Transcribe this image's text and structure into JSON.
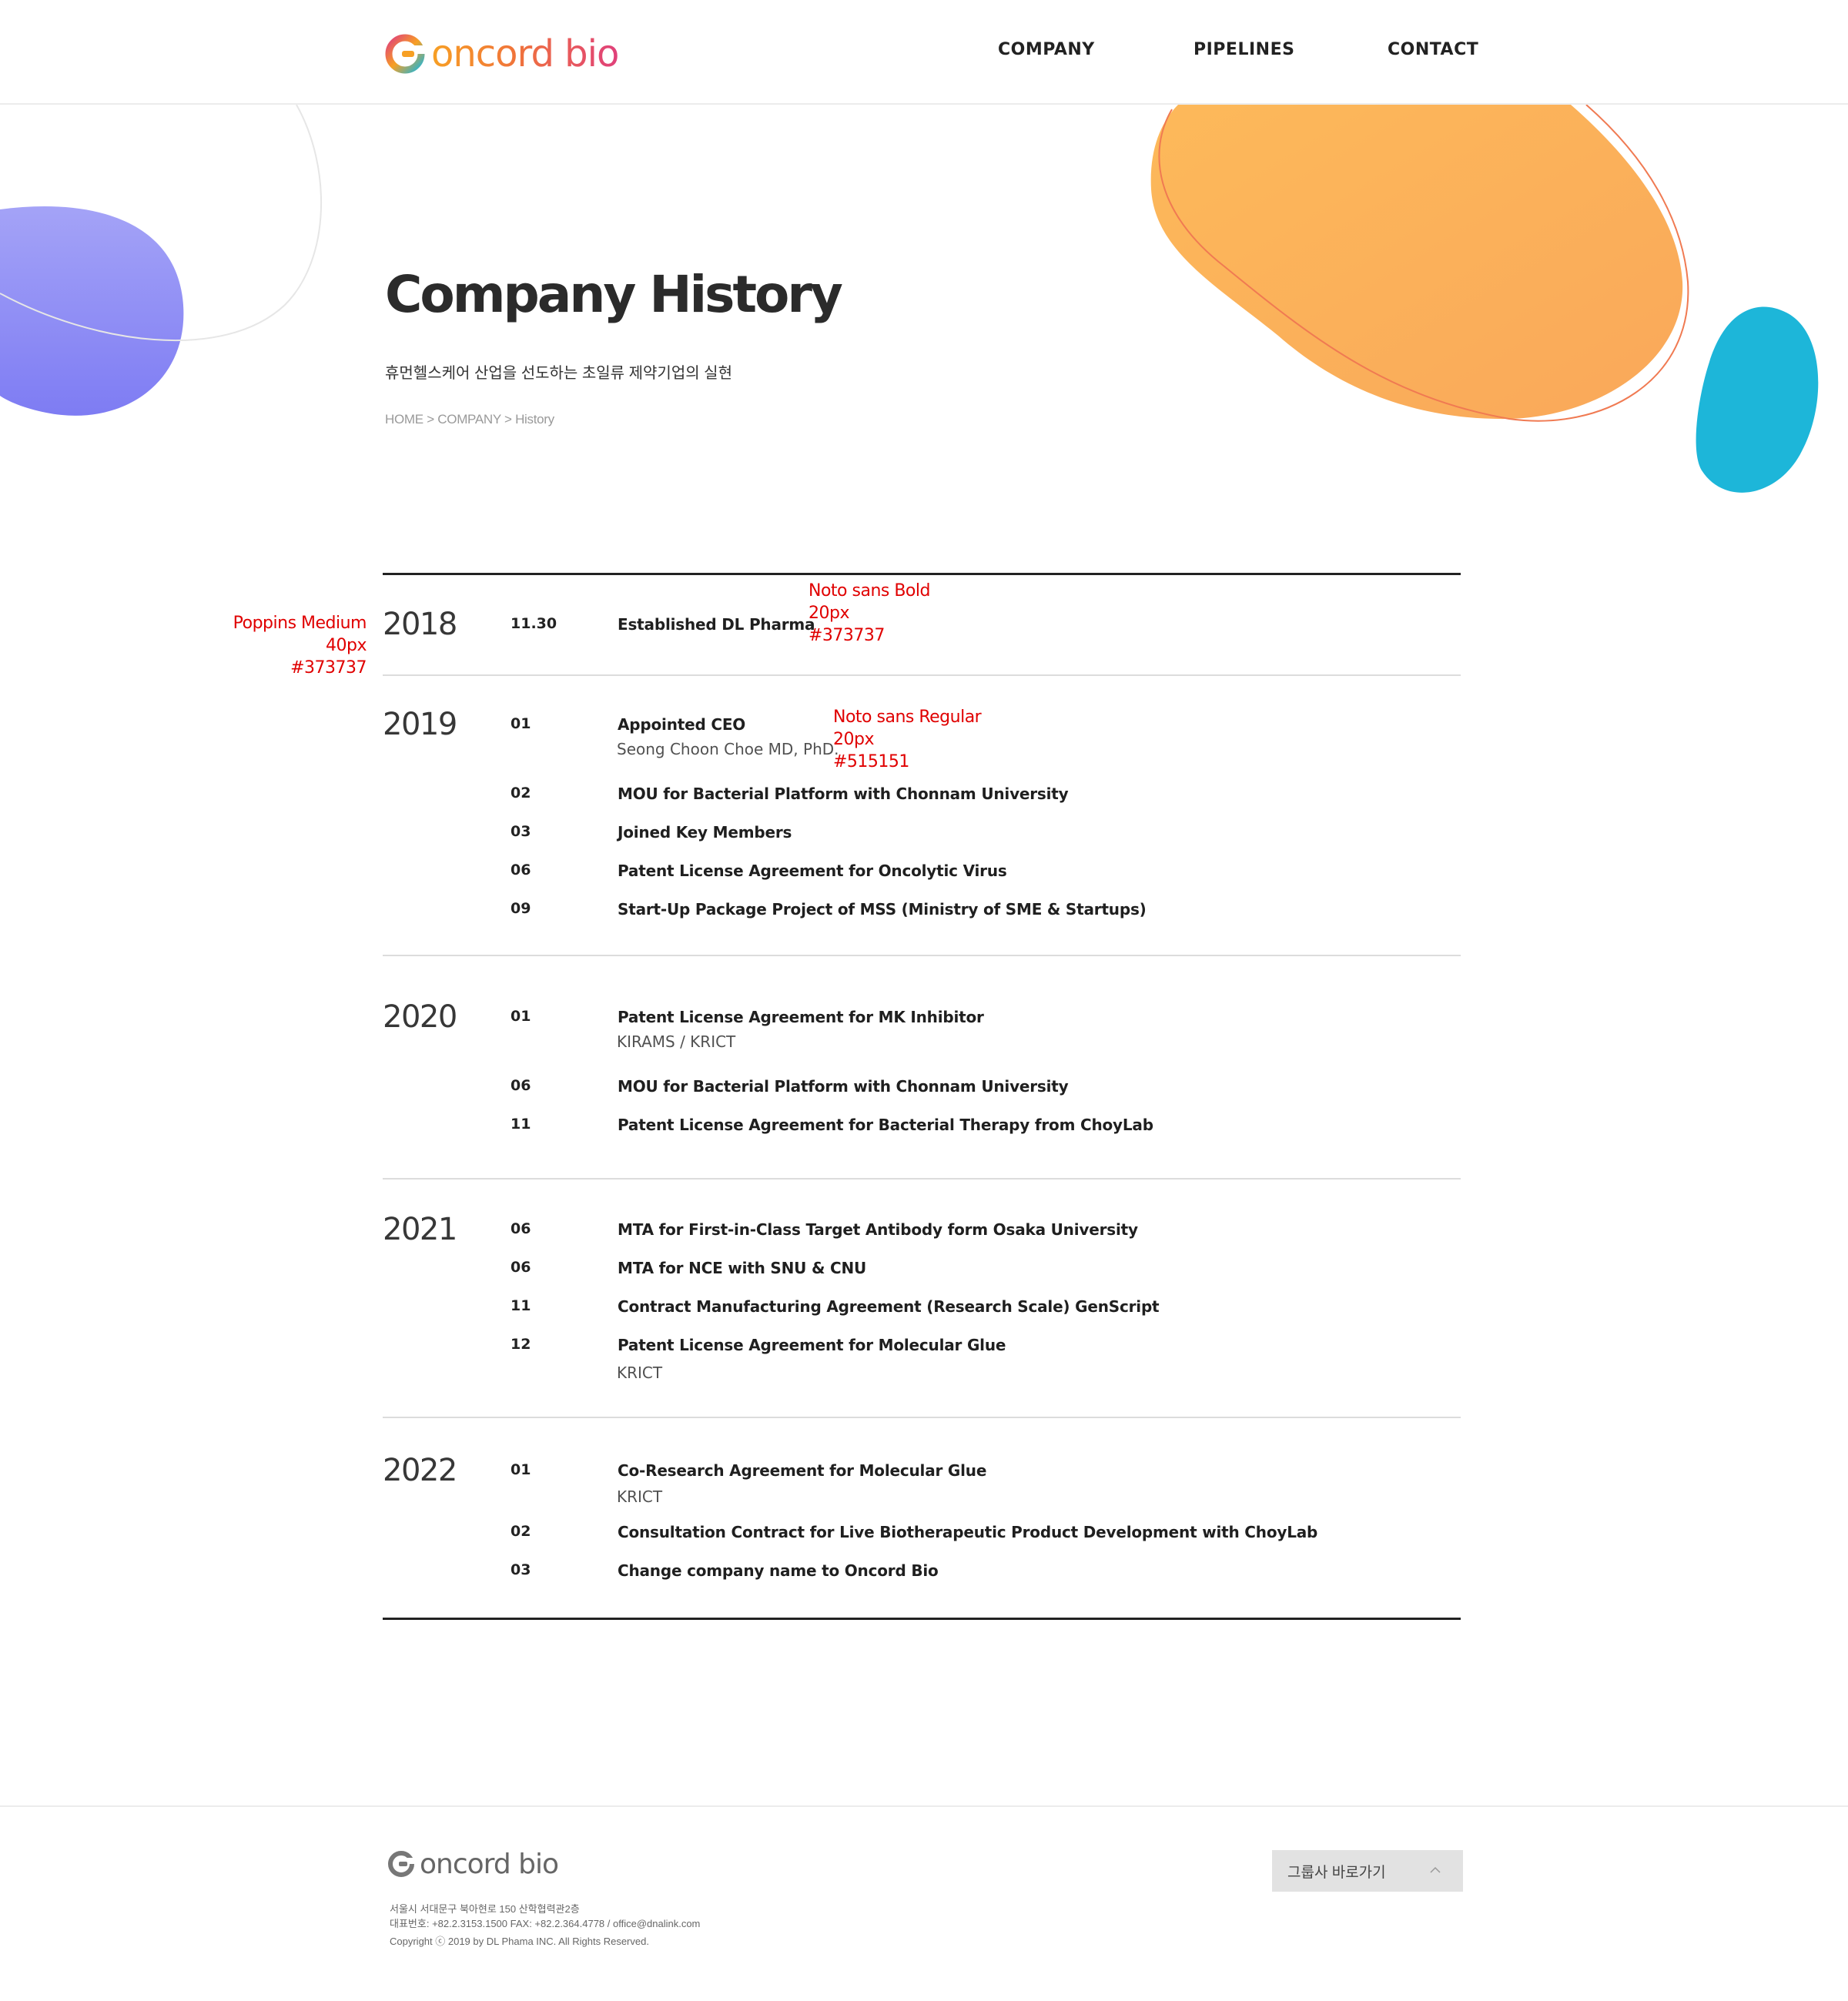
{
  "header": {
    "logo_text": "oncord bio",
    "nav": [
      "COMPANY",
      "PIPELINES",
      "CONTACT"
    ]
  },
  "hero": {
    "title": "Company History",
    "subtitle": "휴먼헬스케어 산업을 선도하는 초일류 제약기업의 실현",
    "breadcrumb": [
      "HOME",
      "COMPANY",
      "History"
    ],
    "breadcrumb_separator": " > "
  },
  "annotations": {
    "year_spec": "Poppins Medium\n40px\n#373737",
    "title_spec": "Noto sans Bold\n20px\n#373737",
    "sub_spec": "Noto sans Regular\n20px\n#515151"
  },
  "history": [
    {
      "year": "2018",
      "events": [
        {
          "date": "11.30",
          "title": "Established DL Pharma"
        }
      ]
    },
    {
      "year": "2019",
      "events": [
        {
          "date": "01",
          "title": "Appointed CEO",
          "sub": "Seong Choon Choe MD, PhD."
        },
        {
          "date": "02",
          "title": "MOU for Bacterial Platform with Chonnam University"
        },
        {
          "date": "03",
          "title": "Joined Key Members"
        },
        {
          "date": "06",
          "title": "Patent License Agreement for Oncolytic Virus"
        },
        {
          "date": "09",
          "title": "Start-Up Package Project of MSS (Ministry of SME & Startups)"
        }
      ]
    },
    {
      "year": "2020",
      "events": [
        {
          "date": "01",
          "title": "Patent License Agreement for MK Inhibitor",
          "sub": "KIRAMS / KRICT"
        },
        {
          "date": "06",
          "title": "MOU for Bacterial Platform with Chonnam University"
        },
        {
          "date": "11",
          "title": "Patent License Agreement for Bacterial Therapy from ChoyLab"
        }
      ]
    },
    {
      "year": "2021",
      "events": [
        {
          "date": "06",
          "title": "MTA for First-in-Class Target Antibody form Osaka University"
        },
        {
          "date": "06",
          "title": "MTA for NCE with SNU & CNU"
        },
        {
          "date": "11",
          "title": "Contract Manufacturing Agreement (Research Scale) GenScript"
        },
        {
          "date": "12",
          "title": "Patent License Agreement for Molecular Glue",
          "sub": "KRICT"
        }
      ]
    },
    {
      "year": "2022",
      "events": [
        {
          "date": "01",
          "title": "Co-Research Agreement for Molecular Glue",
          "sub": "KRICT"
        },
        {
          "date": "02",
          "title": "Consultation Contract for Live Biotherapeutic Product Development with ChoyLab"
        },
        {
          "date": "03",
          "title": "Change company name to Oncord Bio"
        }
      ]
    }
  ],
  "footer": {
    "logo_text": "oncord bio",
    "address": "서울시 서대문구 북아현로 150 산학협력관2층",
    "contact": "대표번호: +82.2.3153.1500   FAX: +82.2.364.4778 / office@dnalink.com",
    "copyright": "Copyright ⓒ 2019 by DL Phama INC. All Rights Reserved.",
    "family_site_label": "그룹사 바로가기"
  },
  "colors": {
    "brand_orange": "#f7a024",
    "brand_pink": "#e0407b",
    "blob_orange": "#fbb257",
    "blob_cyan": "#1db6d9",
    "blob_violet": "#8b89f7",
    "annotation_red": "#e00000",
    "year_text": "#373737",
    "sub_text": "#515151"
  }
}
